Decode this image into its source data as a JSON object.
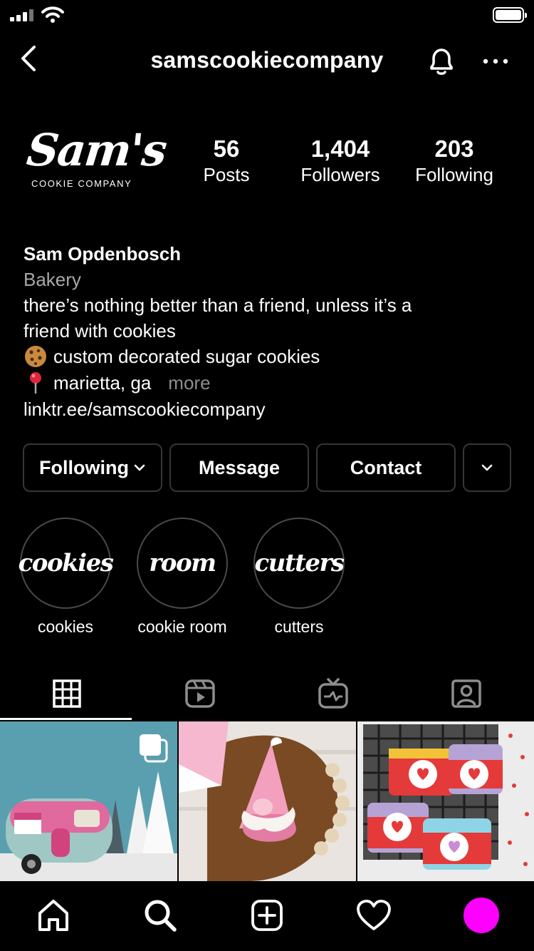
{
  "header": {
    "username": "samscookiecompany"
  },
  "profile": {
    "logo_main": "Sam's",
    "logo_sub": "COOKIE COMPANY",
    "stats": [
      {
        "value": "56",
        "label": "Posts"
      },
      {
        "value": "1,404",
        "label": "Followers"
      },
      {
        "value": "203",
        "label": "Following"
      }
    ]
  },
  "bio": {
    "name": "Sam Opdenbosch",
    "category": "Bakery",
    "line1": "there’s nothing better than a friend, unless it’s a",
    "line2": "friend with cookies",
    "line3_emoji": "cookie-icon",
    "line3": "custom decorated sugar cookies",
    "line4_emoji": "pin-icon",
    "line4": "marietta, ga",
    "more": "more",
    "link": "linktr.ee/samscookiecompany"
  },
  "actions": {
    "following": "Following",
    "message": "Message",
    "contact": "Contact"
  },
  "highlights": [
    {
      "cover_text": "cookies",
      "caption": "cookies"
    },
    {
      "cover_text": "room",
      "caption": "cookie room"
    },
    {
      "cover_text": "cutters",
      "caption": "cutters"
    }
  ],
  "colors": {
    "background": "#000000",
    "border": "#363636",
    "muted": "#a8a8a8",
    "profile_accent": "#ff00ff"
  }
}
